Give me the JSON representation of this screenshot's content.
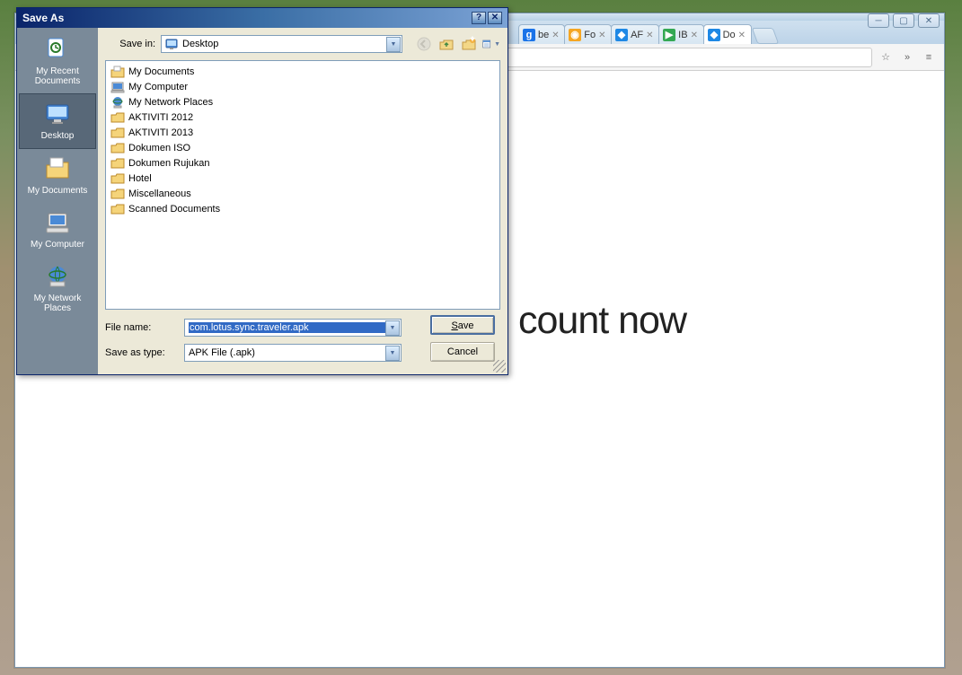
{
  "browser": {
    "window_controls": {
      "min": "─",
      "max": "▢",
      "close": "✕"
    },
    "tabs": [
      {
        "icon_color": "#1a73e8",
        "icon_text": "g",
        "label": "be"
      },
      {
        "icon_color": "#f5a623",
        "icon_text": "◉",
        "label": "Fo"
      },
      {
        "icon_color": "#1e88e5",
        "icon_text": "◆",
        "label": "AF"
      },
      {
        "icon_color": "#34a853",
        "icon_text": "▶",
        "label": "IB"
      },
      {
        "icon_color": "#1e88e5",
        "icon_text": "◆",
        "label": "Do",
        "active": true
      }
    ],
    "toolbar": {
      "star": "☆",
      "chevrons": "»",
      "menu": "≡"
    },
    "page_text": "count now"
  },
  "dialog": {
    "title": "Save As",
    "help": "?",
    "close": "✕",
    "savein_label": "Save in:",
    "savein_value": "Desktop",
    "places": [
      {
        "label": "My Recent Documents",
        "icon": "recent"
      },
      {
        "label": "Desktop",
        "icon": "desktop",
        "selected": true
      },
      {
        "label": "My Documents",
        "icon": "mydocs"
      },
      {
        "label": "My Computer",
        "icon": "mycomp"
      },
      {
        "label": "My Network Places",
        "icon": "netplaces"
      }
    ],
    "files": [
      {
        "icon": "mydocs",
        "name": "My Documents"
      },
      {
        "icon": "mycomp",
        "name": "My Computer"
      },
      {
        "icon": "netplaces",
        "name": "My Network Places"
      },
      {
        "icon": "folder",
        "name": "AKTIVITI 2012"
      },
      {
        "icon": "folder",
        "name": "AKTIVITI 2013"
      },
      {
        "icon": "folder",
        "name": "Dokumen ISO"
      },
      {
        "icon": "folder",
        "name": "Dokumen Rujukan"
      },
      {
        "icon": "folder",
        "name": "Hotel"
      },
      {
        "icon": "folder",
        "name": "Miscellaneous"
      },
      {
        "icon": "folder",
        "name": "Scanned Documents"
      }
    ],
    "filename_label": "File name:",
    "filename_value": "com.lotus.sync.traveler.apk",
    "saveastype_label": "Save as type:",
    "saveastype_value": "APK File (.apk)",
    "save_btn": "Save",
    "cancel_btn": "Cancel"
  }
}
